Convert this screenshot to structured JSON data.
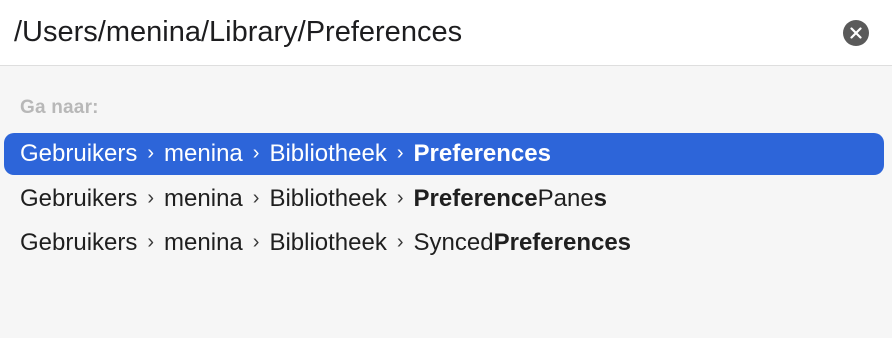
{
  "search": {
    "value": "/Users/menina/Library/Preferences",
    "clear_icon": "clear-icon"
  },
  "section_label": "Ga naar:",
  "rows": [
    {
      "segments": [
        "Gebruikers",
        "menina",
        "Bibliotheek"
      ],
      "separator": "›",
      "last": {
        "pre": "",
        "bold": "Preferences",
        "mid": "",
        "bold2": ""
      },
      "selected": true
    },
    {
      "segments": [
        "Gebruikers",
        "menina",
        "Bibliotheek"
      ],
      "separator": "›",
      "last": {
        "pre": "",
        "bold": "Preference",
        "mid": "Pane",
        "bold2": "s"
      },
      "selected": false
    },
    {
      "segments": [
        "Gebruikers",
        "menina",
        "Bibliotheek"
      ],
      "separator": "›",
      "last": {
        "pre": "Synced",
        "bold": "Preferences",
        "mid": "",
        "bold2": ""
      },
      "selected": false
    }
  ],
  "colors": {
    "selection": "#2d65d9",
    "background": "#f6f6f6",
    "label": "#b8b8b8"
  }
}
